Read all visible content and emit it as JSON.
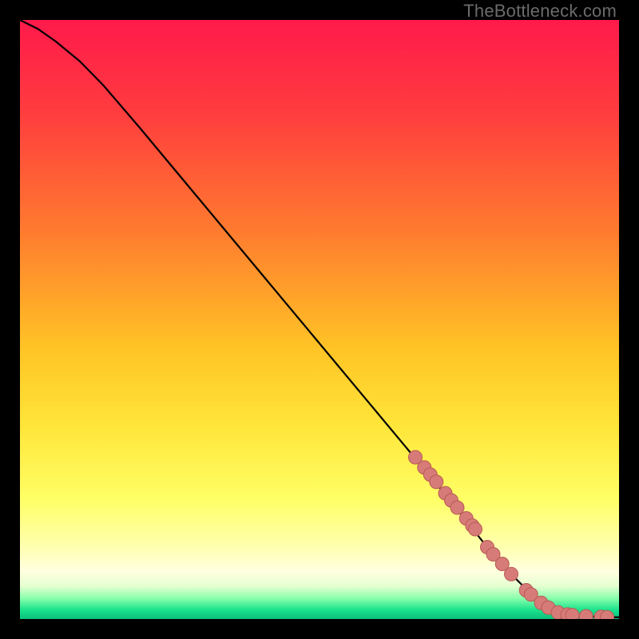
{
  "watermark": "TheBottleneck.com",
  "colors": {
    "black": "#000000",
    "curve": "#000000",
    "marker_fill": "#d77b78",
    "marker_stroke": "#b85b56",
    "gradient_stops": [
      {
        "offset": 0.0,
        "color": "#ff1a4b"
      },
      {
        "offset": 0.15,
        "color": "#ff3b3f"
      },
      {
        "offset": 0.35,
        "color": "#ff7a2f"
      },
      {
        "offset": 0.55,
        "color": "#ffc425"
      },
      {
        "offset": 0.68,
        "color": "#ffe63a"
      },
      {
        "offset": 0.8,
        "color": "#ffff66"
      },
      {
        "offset": 0.88,
        "color": "#ffffb0"
      },
      {
        "offset": 0.92,
        "color": "#ffffe0"
      },
      {
        "offset": 0.945,
        "color": "#e6ffd0"
      },
      {
        "offset": 0.965,
        "color": "#8affac"
      },
      {
        "offset": 0.985,
        "color": "#1ae28b"
      },
      {
        "offset": 1.0,
        "color": "#0bbf7d"
      }
    ]
  },
  "chart_data": {
    "type": "line",
    "title": "",
    "xlabel": "",
    "ylabel": "",
    "xlim": [
      0,
      100
    ],
    "ylim": [
      0,
      100
    ],
    "series": [
      {
        "name": "curve",
        "x": [
          0,
          3,
          6,
          10,
          14,
          20,
          30,
          40,
          50,
          60,
          70,
          78,
          82,
          85,
          88,
          90,
          92,
          95,
          98,
          100
        ],
        "y": [
          100,
          98.5,
          96.4,
          93.1,
          89.0,
          82.0,
          70.0,
          58.0,
          46.0,
          34.0,
          22.0,
          12.0,
          7.5,
          4.5,
          2.3,
          1.3,
          0.8,
          0.45,
          0.3,
          0.3
        ]
      }
    ],
    "markers": {
      "name": "highlighted-points",
      "x": [
        66,
        67.5,
        68.5,
        69.5,
        71,
        72,
        73,
        74.5,
        75.5,
        76,
        78,
        79,
        80.5,
        82,
        84.5,
        85.3,
        87,
        88.2,
        89.8,
        91.4,
        92.2,
        94.5,
        97,
        98
      ],
      "y": [
        27.0,
        25.3,
        24.1,
        22.9,
        21.0,
        19.8,
        18.6,
        16.8,
        15.6,
        15.0,
        12.0,
        10.8,
        9.2,
        7.5,
        4.8,
        4.1,
        2.7,
        1.9,
        1.1,
        0.75,
        0.65,
        0.45,
        0.35,
        0.3
      ]
    }
  }
}
